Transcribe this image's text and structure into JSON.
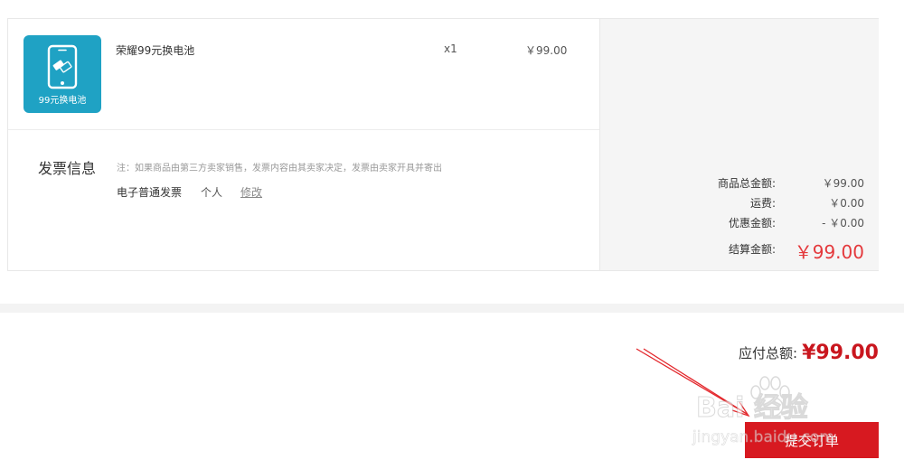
{
  "product": {
    "thumbnail_caption": "99元换电池",
    "name": "荣耀99元换电池",
    "quantity": "x1",
    "price": "￥99.00"
  },
  "invoice": {
    "title": "发票信息",
    "note": "注：如果商品由第三方卖家销售，发票内容由其卖家决定，发票由卖家开具并寄出",
    "type": "电子普通发票",
    "holder": "个人",
    "edit_label": "修改"
  },
  "summary": {
    "items": [
      {
        "label": "商品总金额:",
        "value": "￥99.00"
      },
      {
        "label": "运费:",
        "value": "￥0.00"
      },
      {
        "label": "优惠金额:",
        "value": "- ￥0.00"
      }
    ],
    "final_label": "结算金额:",
    "final_value": "￥99.00"
  },
  "footer": {
    "pay_label": "应付总额:",
    "pay_amount": "¥99.00",
    "submit_label": "提交订单"
  },
  "watermark": {
    "main": "Bai 经验",
    "sub": "jingyan.baidu.com"
  },
  "colors": {
    "accent_red": "#d71920",
    "price_red": "#e4393c",
    "thumb_blue": "#1fa2c4"
  }
}
